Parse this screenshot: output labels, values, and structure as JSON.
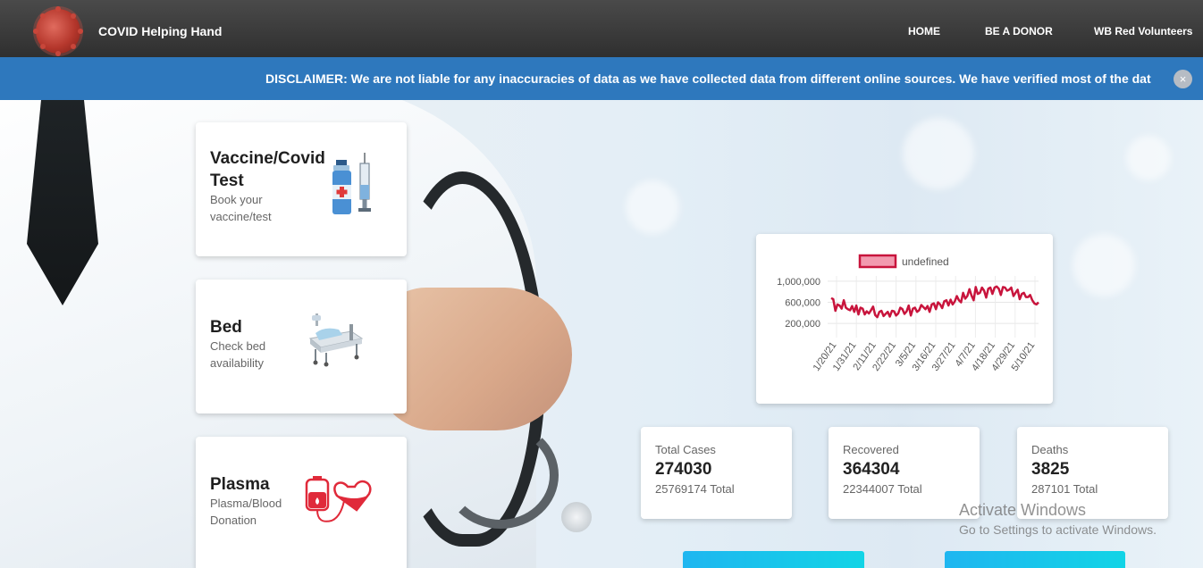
{
  "navbar": {
    "brand": "COVID Helping Hand",
    "links": [
      "HOME",
      "BE A DONOR",
      "WB Red Volunteers"
    ]
  },
  "disclaimer": {
    "text": "DISCLAIMER: We are not liable for any inaccuracies of data as we have collected data from different online sources. We have verified most of the dat",
    "close_label": "×"
  },
  "services": [
    {
      "title": "Vaccine/Covid Test",
      "subtitle": "Book your vaccine/test",
      "icon": "vaccine-syringe-icon"
    },
    {
      "title": "Bed",
      "subtitle": "Check bed availability",
      "icon": "hospital-bed-icon"
    },
    {
      "title": "Plasma",
      "subtitle": "Plasma/Blood Donation",
      "icon": "blood-bag-heart-icon"
    }
  ],
  "chart_data": {
    "type": "line",
    "legend": "undefined",
    "series_color": "#c8143c",
    "y_ticks": [
      "1,000,000",
      "600,000",
      "200,000"
    ],
    "x_ticks": [
      "1/20/21",
      "1/31/21",
      "2/11/21",
      "2/22/21",
      "3/5/21",
      "3/16/21",
      "3/27/21",
      "4/7/21",
      "4/18/21",
      "4/29/21",
      "5/10/21"
    ],
    "ylim": [
      0,
      1100000
    ],
    "values": [
      680000,
      660000,
      440000,
      560000,
      540000,
      480000,
      640000,
      500000,
      470000,
      450000,
      530000,
      420000,
      540000,
      370000,
      500000,
      480000,
      370000,
      430000,
      390000,
      450000,
      520000,
      360000,
      320000,
      420000,
      440000,
      340000,
      380000,
      420000,
      330000,
      440000,
      430000,
      350000,
      390000,
      500000,
      470000,
      380000,
      430000,
      540000,
      350000,
      480000,
      500000,
      420000,
      450000,
      550000,
      510000,
      470000,
      530000,
      420000,
      560000,
      580000,
      470000,
      600000,
      560000,
      490000,
      620000,
      640000,
      540000,
      650000,
      560000,
      620000,
      720000,
      640000,
      600000,
      780000,
      670000,
      720000,
      850000,
      730000,
      640000,
      890000,
      760000,
      780000,
      880000,
      820000,
      690000,
      860000,
      880000,
      760000,
      880000,
      900000,
      860000,
      740000,
      890000,
      880000,
      820000,
      840000,
      880000,
      720000,
      780000,
      840000,
      660000,
      760000,
      780000,
      700000,
      700000,
      740000,
      640000,
      580000,
      560000,
      600000
    ]
  },
  "stats": [
    {
      "label": "Total Cases",
      "value": "274030",
      "total": "25769174 Total"
    },
    {
      "label": "Recovered",
      "value": "364304",
      "total": "22344007 Total"
    },
    {
      "label": "Deaths",
      "value": "3825",
      "total": "287101 Total"
    }
  ],
  "watermark": {
    "title": "Activate Windows",
    "subtitle": "Go to Settings to activate Windows."
  }
}
